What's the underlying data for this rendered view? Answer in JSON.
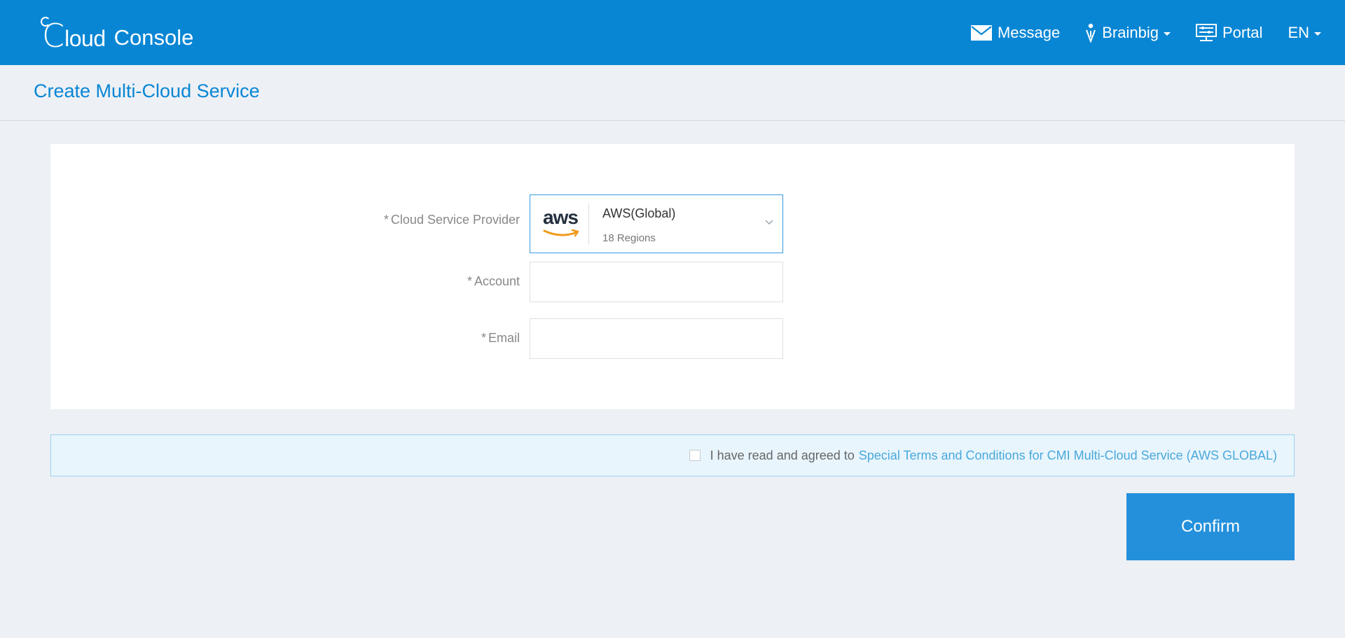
{
  "header": {
    "logo_c": "C",
    "logo_loud": "loud",
    "logo_console": "Console",
    "nav": {
      "message": "Message",
      "user": "Brainbig",
      "portal": "Portal",
      "language": "EN"
    }
  },
  "page": {
    "title": "Create Multi-Cloud Service"
  },
  "form": {
    "required_mark": "*",
    "provider": {
      "label": "Cloud Service Provider",
      "logo_text": "aws",
      "name": "AWS(Global)",
      "sub": "18 Regions"
    },
    "account": {
      "label": "Account",
      "value": ""
    },
    "email": {
      "label": "Email",
      "value": ""
    }
  },
  "agreement": {
    "text": "I have read and agreed to",
    "link": "Special Terms and Conditions for CMI Multi-Cloud Service (AWS GLOBAL)",
    "checked": false
  },
  "actions": {
    "confirm": "Confirm"
  },
  "colors": {
    "header_bg": "#0886d4",
    "page_bg": "#edf0f5",
    "title": "#0886d4",
    "primary_button": "#2490dc",
    "link": "#4aa8dc",
    "aws_orange": "#f29a1f"
  }
}
